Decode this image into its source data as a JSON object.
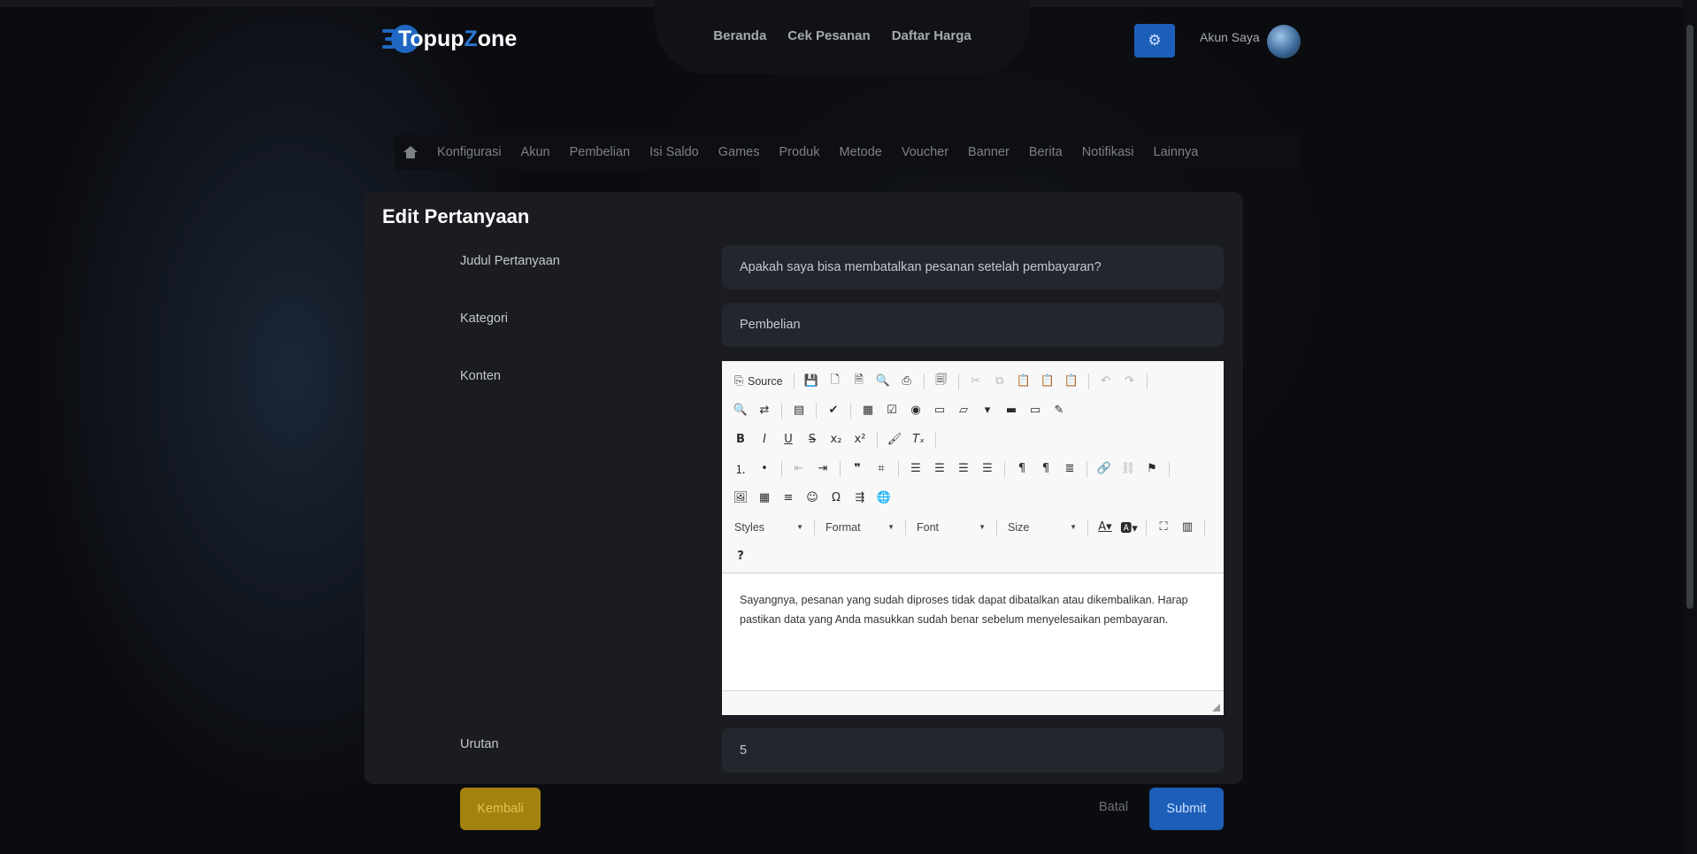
{
  "brand": {
    "name_part1": "Topup",
    "name_part2": "Z",
    "name_part3": "one",
    "accent": "#1f67c2"
  },
  "nav": {
    "items": [
      {
        "label": "Beranda"
      },
      {
        "label": "Cek Pesanan"
      },
      {
        "label": "Daftar Harga"
      }
    ]
  },
  "account": {
    "label": "Akun Saya",
    "settings_icon": "gear-icon"
  },
  "subnav": {
    "home_icon": "home-icon",
    "items": [
      {
        "label": "Konfigurasi"
      },
      {
        "label": "Akun"
      },
      {
        "label": "Pembelian"
      },
      {
        "label": "Isi Saldo"
      },
      {
        "label": "Games"
      },
      {
        "label": "Produk"
      },
      {
        "label": "Metode"
      },
      {
        "label": "Voucher"
      },
      {
        "label": "Banner"
      },
      {
        "label": "Berita"
      },
      {
        "label": "Notifikasi"
      },
      {
        "label": "Lainnya"
      }
    ]
  },
  "form": {
    "title": "Edit Pertanyaan",
    "judul_label": "Judul Pertanyaan",
    "judul_value": "Apakah saya bisa membatalkan pesanan setelah pembayaran?",
    "kategori_label": "Kategori",
    "kategori_value": "Pembelian",
    "konten_label": "Konten",
    "urutan_label": "Urutan",
    "urutan_value": "5"
  },
  "editor": {
    "source_label": "Source",
    "styles_label": "Styles",
    "format_label": "Format",
    "font_label": "Font",
    "size_label": "Size",
    "content": "Sayangnya, pesanan yang sudah diproses tidak dapat dibatalkan atau dikembalikan. Harap pastikan data yang Anda masukkan sudah benar sebelum menyelesaikan pembayaran."
  },
  "actions": {
    "back_label": "Kembali",
    "cancel_label": "Batal",
    "submit_label": "Submit"
  }
}
